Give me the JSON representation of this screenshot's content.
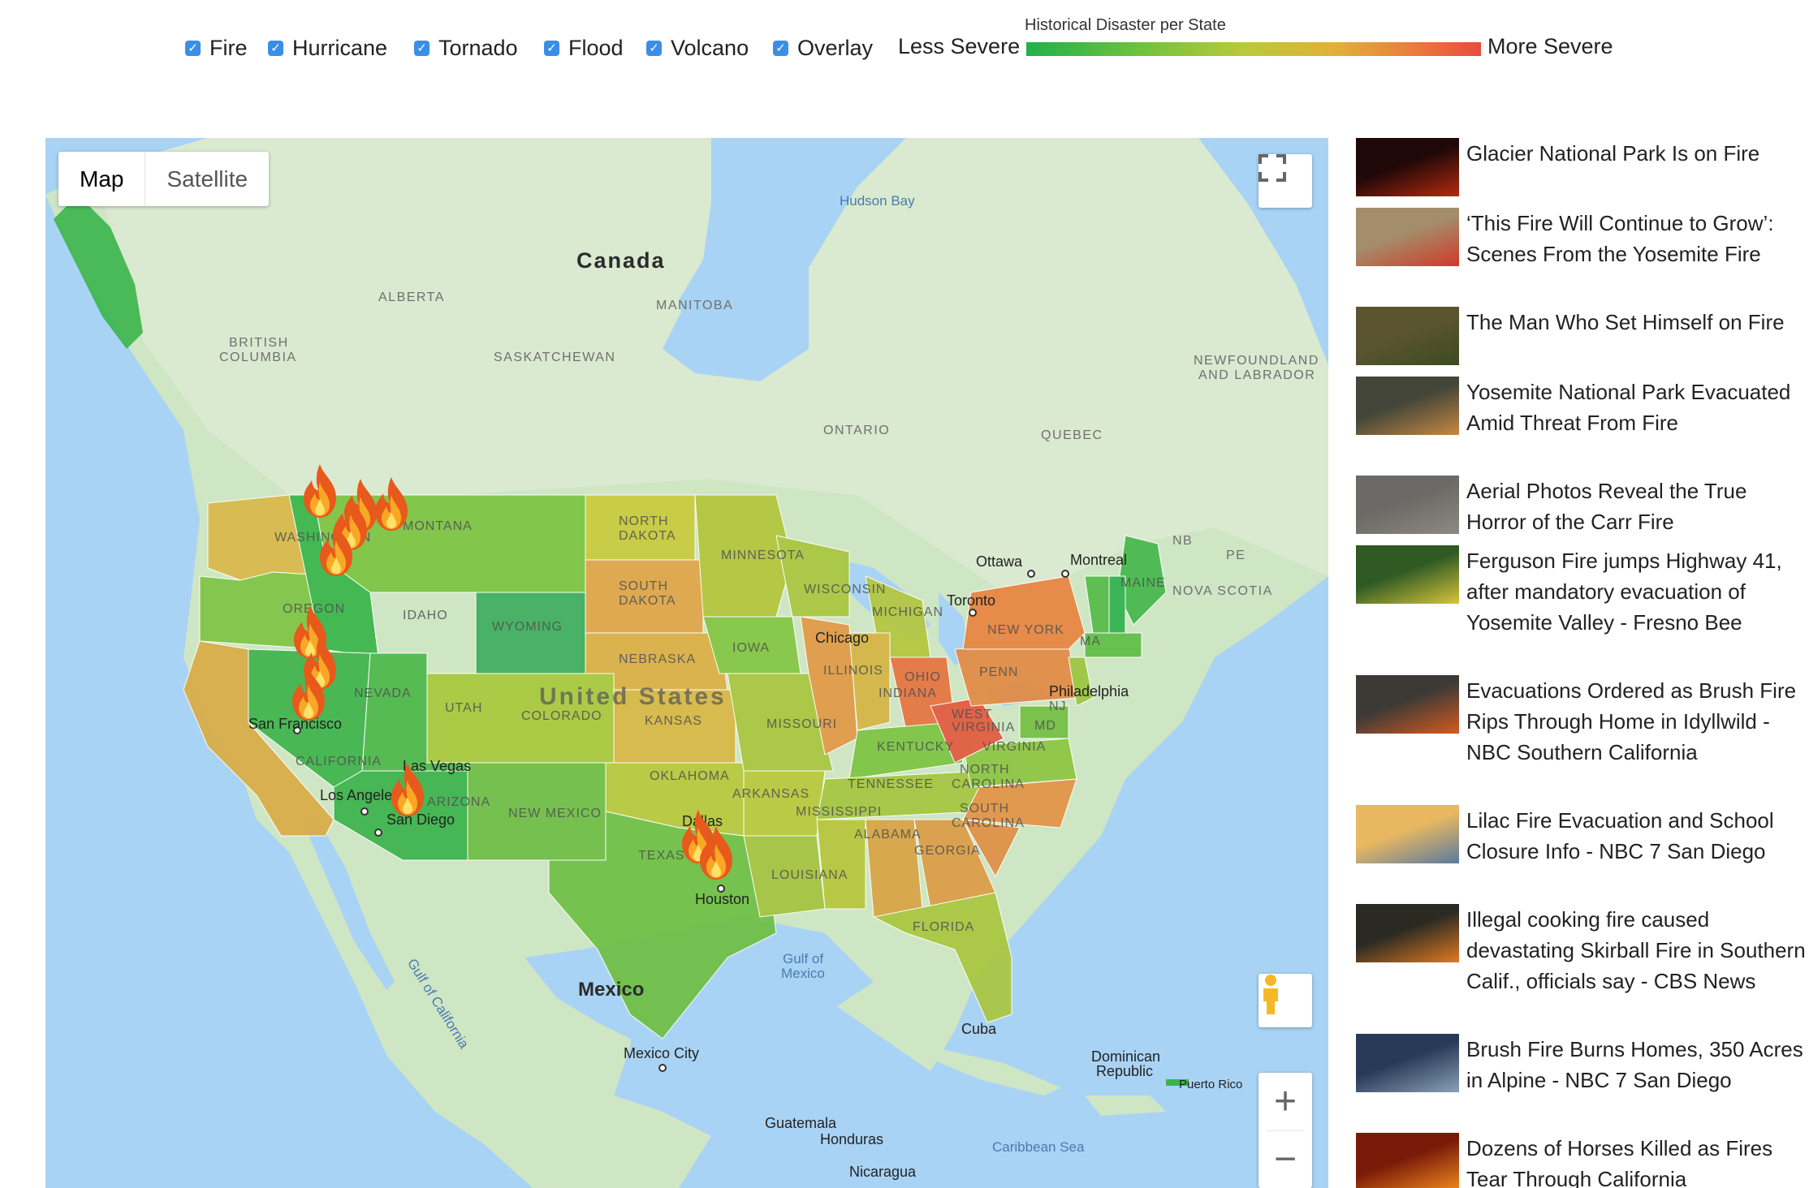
{
  "filters": [
    {
      "label": "Fire",
      "checked": true
    },
    {
      "label": "Hurricane",
      "checked": true
    },
    {
      "label": "Tornado",
      "checked": true
    },
    {
      "label": "Flood",
      "checked": true
    },
    {
      "label": "Volcano",
      "checked": true
    },
    {
      "label": "Overlay",
      "checked": true
    }
  ],
  "legend": {
    "title": "Historical Disaster per State",
    "less_label": "Less Severe",
    "more_label": "More Severe",
    "colors": [
      "#1fb14b",
      "#b9c93a",
      "#e2b03a",
      "#e94a3e"
    ]
  },
  "map": {
    "type_buttons": {
      "map": "Map",
      "satellite": "Satellite"
    },
    "active_type": "Map",
    "labels": {
      "canada": "Canada",
      "united_states": "United States",
      "mexico": "Mexico",
      "hudson_bay": "Hudson Bay",
      "alberta": "ALBERTA",
      "manitoba": "MANITOBA",
      "british_columbia_1": "BRITISH",
      "british_columbia_2": "COLUMBIA",
      "saskatchewan": "SASKATCHEWAN",
      "ontario": "ONTARIO",
      "quebec": "QUEBEC",
      "newfoundland_1": "NEWFOUNDLAND",
      "newfoundland_2": "AND LABRADOR",
      "nb": "NB",
      "pe": "PE",
      "nova_scotia": "NOVA SCOTIA",
      "ottawa": "Ottawa",
      "montreal": "Montreal",
      "toronto": "Toronto",
      "chicago": "Chicago",
      "philadelphia": "Philadelphia",
      "san_francisco": "San Francisco",
      "las_vegas": "Las Vegas",
      "los_angeles": "Los Angeles",
      "san_diego": "San Diego",
      "dallas": "Dallas",
      "houston": "Houston",
      "gulf_of_california": "Gulf of California",
      "gulf_of_mexico_1": "Gulf of",
      "gulf_of_mexico_2": "Mexico",
      "mexico_city": "Mexico City",
      "cuba": "Cuba",
      "dominican_1": "Dominican",
      "dominican_2": "Republic",
      "puerto_rico": "Puerto Rico",
      "guatemala": "Guatemala",
      "honduras": "Honduras",
      "nicaragua": "Nicaragua",
      "caribbean_sea": "Caribbean Sea"
    },
    "state_labels": {
      "washington": "WASHINGTON",
      "oregon": "OREGON",
      "idaho": "IDAHO",
      "montana": "MONTANA",
      "wyoming": "WYOMING",
      "nevada": "NEVADA",
      "utah": "UTAH",
      "colorado": "COLORADO",
      "california": "CALIFORNIA",
      "arizona": "ARIZONA",
      "new_mexico": "NEW MEXICO",
      "north_dakota_1": "NORTH",
      "north_dakota_2": "DAKOTA",
      "south_dakota_1": "SOUTH",
      "south_dakota_2": "DAKOTA",
      "nebraska": "NEBRASKA",
      "kansas": "KANSAS",
      "oklahoma": "OKLAHOMA",
      "texas": "TEXAS",
      "minnesota": "MINNESOTA",
      "iowa": "IOWA",
      "missouri": "MISSOURI",
      "arkansas": "ARKANSAS",
      "louisiana": "LOUISIANA",
      "wisconsin": "WISCONSIN",
      "illinois": "ILLINOIS",
      "michigan": "MICHIGAN",
      "indiana": "INDIANA",
      "ohio": "OHIO",
      "kentucky": "KENTUCKY",
      "tennessee": "TENNESSEE",
      "mississippi": "MISSISSIPPI",
      "alabama": "ALABAMA",
      "georgia": "GEORGIA",
      "florida": "FLORIDA",
      "south_carolina_1": "SOUTH",
      "south_carolina_2": "CAROLINA",
      "north_carolina_1": "NORTH",
      "north_carolina_2": "CAROLINA",
      "virginia": "VIRGINIA",
      "west_virginia_1": "WEST",
      "west_virginia_2": "VIRGINIA",
      "penn": "PENN",
      "new_york": "NEW YORK",
      "nj": "NJ",
      "maine": "MAINE",
      "ma": "MA",
      "md": "MD"
    },
    "state_colors": {
      "wa": "#d9b84a",
      "or": "#7fc544",
      "ca": "#d9ac45",
      "id": "#39b54a",
      "nv": "#3fb44c",
      "ut": "#4db84a",
      "az": "#3cb34b",
      "mt": "#7cc442",
      "wy": "#3fae5f",
      "co": "#a9c83c",
      "nm": "#6fbd45",
      "nd": "#c9ca3c",
      "sd": "#e0a448",
      "ne": "#dcaf46",
      "ks": "#d8b844",
      "ok": "#b7c83c",
      "tx": "#6fbf44",
      "mn": "#b2c63c",
      "ia": "#83c642",
      "mo": "#a9c63e",
      "ar": "#b9c83c",
      "la": "#a4c43f",
      "wi": "#a8c63e",
      "il": "#e19a45",
      "mi": "#b3c63d",
      "in": "#d6b543",
      "oh": "#e6743f",
      "ky": "#7cc442",
      "tn": "#a4c640",
      "ms": "#b7c63c",
      "al": "#d8a344",
      "ga": "#db9d45",
      "fl": "#aac63e",
      "sc": "#e08f44",
      "nc": "#e39346",
      "va": "#8cc642",
      "wv": "#e25a3e",
      "pa": "#e28a43",
      "ny": "#e8843f",
      "me": "#46b84b",
      "nh": "#2eb34d",
      "vt": "#56bb48",
      "ma": "#5fbe46",
      "nj": "#9dc53f",
      "md": "#73c043"
    },
    "controls": {
      "zoom_in": "+",
      "zoom_out": "−"
    }
  },
  "news": [
    {
      "title": "Glacier National Park Is on Fire",
      "thumb_colors": [
        "#200808",
        "#b42a10"
      ]
    },
    {
      "title": "‘This Fire Will Continue to Grow’: Scenes From the Yosemite Fire",
      "thumb_colors": [
        "#a48d6a",
        "#d03a2a"
      ]
    },
    {
      "title": "The Man Who Set Himself on Fire",
      "thumb_colors": [
        "#5a5530",
        "#3d4a20"
      ]
    },
    {
      "title": "Yosemite National Park Evacuated Amid Threat From Fire",
      "thumb_colors": [
        "#434638",
        "#c78843"
      ]
    },
    {
      "title": "Aerial Photos Reveal the True Horror of the Carr Fire",
      "thumb_colors": [
        "#6b6a66",
        "#8d8a80"
      ]
    },
    {
      "title": "Ferguson Fire jumps Highway 41, after mandatory evacuation of Yosemite Valley - Fresno Bee",
      "thumb_colors": [
        "#2f5a24",
        "#d7c43a"
      ]
    },
    {
      "title": "Evacuations Ordered as Brush Fire Rips Through Home in Idyllwild - NBC Southern California",
      "thumb_colors": [
        "#3d3a36",
        "#d55a20"
      ]
    },
    {
      "title": "Lilac Fire Evacuation and School Closure Info - NBC 7 San Diego",
      "thumb_colors": [
        "#e8b860",
        "#5a7aa0"
      ]
    },
    {
      "title": "Illegal cooking fire caused devastating Skirball Fire in Southern Calif., officials say - CBS News",
      "thumb_colors": [
        "#2a2a22",
        "#e27a22"
      ]
    },
    {
      "title": "Brush Fire Burns Homes, 350 Acres in Alpine - NBC 7 San Diego",
      "thumb_colors": [
        "#283a58",
        "#8aa0b8"
      ]
    },
    {
      "title": "Dozens of Horses Killed as Fires Tear Through California",
      "thumb_colors": [
        "#7a1a08",
        "#f08a20"
      ]
    }
  ]
}
